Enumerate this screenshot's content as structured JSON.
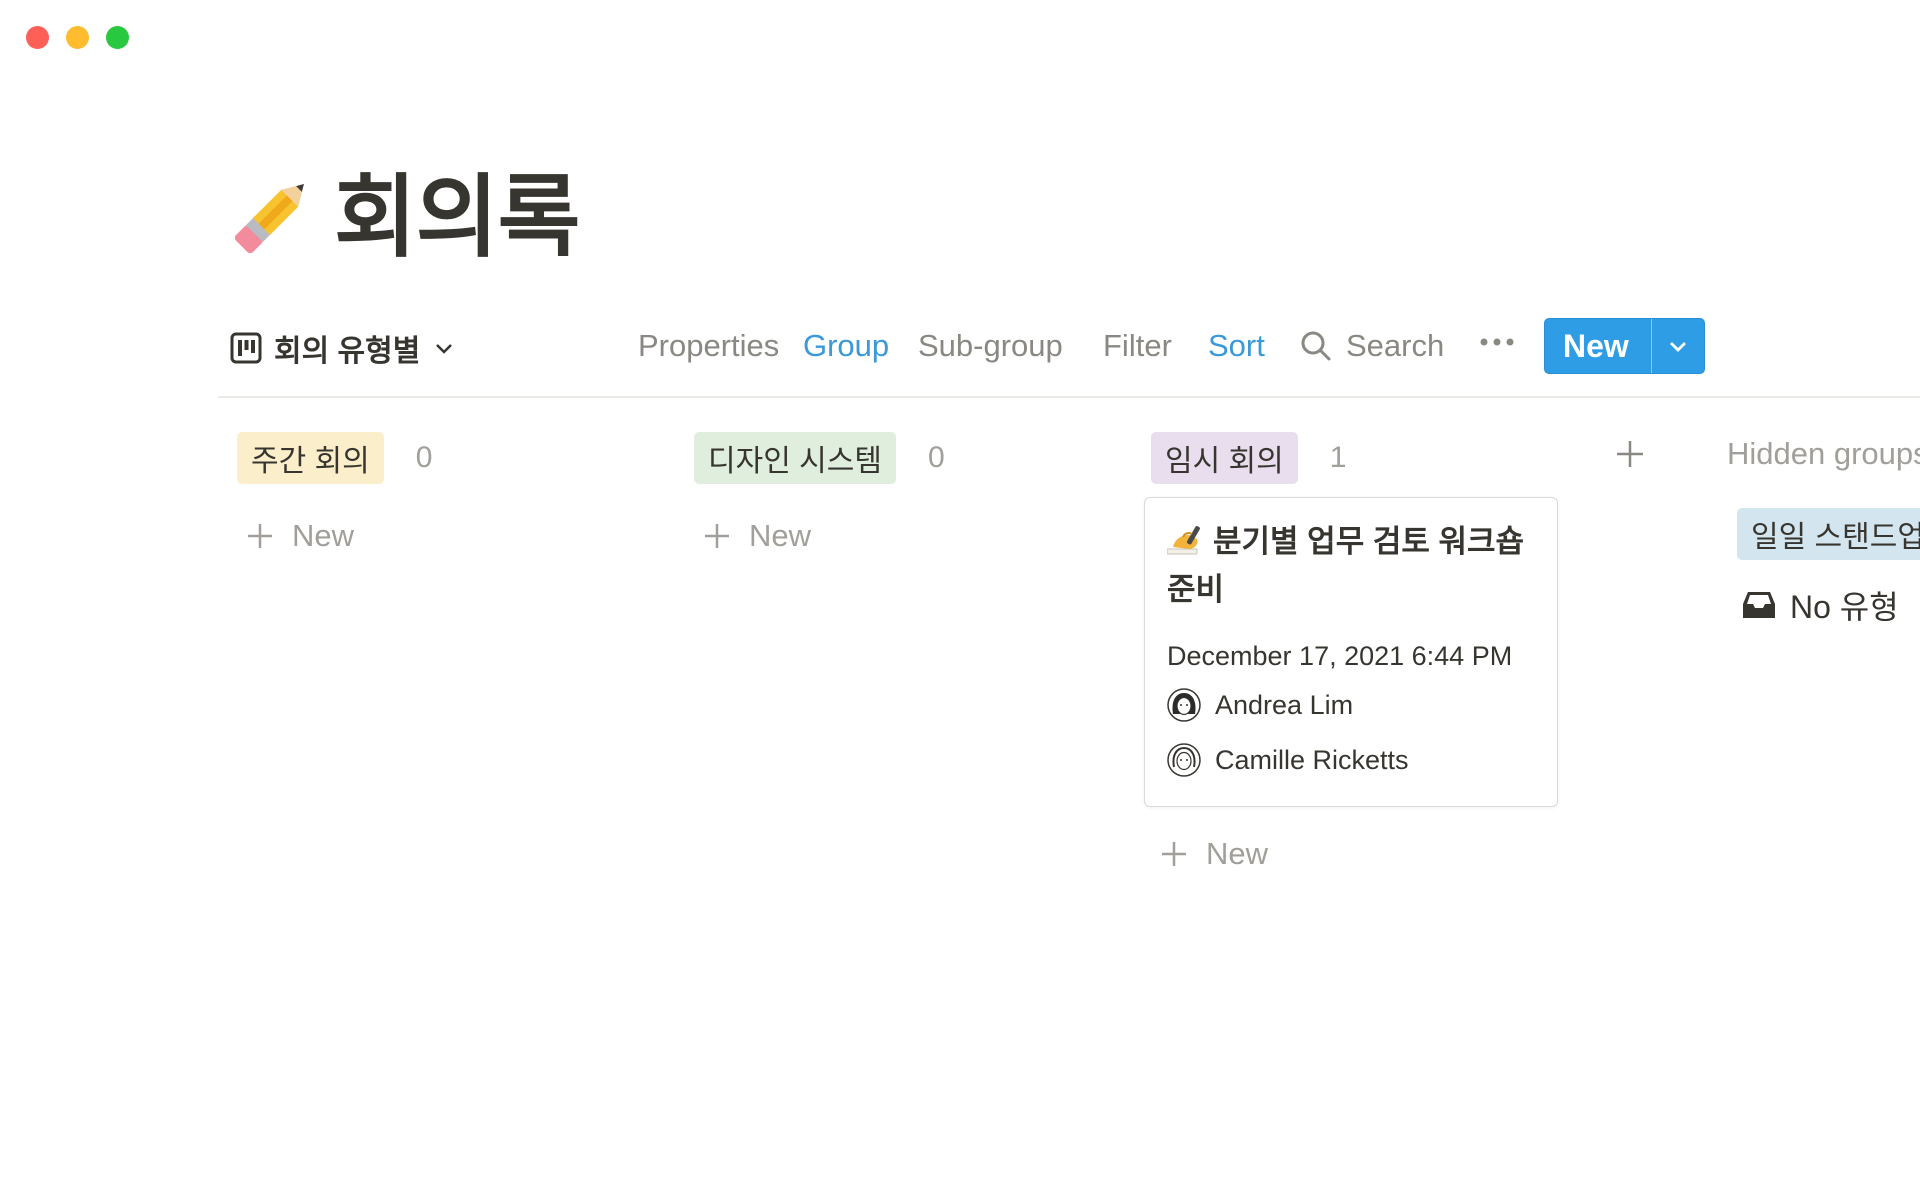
{
  "window": {
    "controls": [
      "close",
      "minimize",
      "zoom"
    ]
  },
  "page": {
    "icon": "pencil-icon",
    "title": "회의록"
  },
  "toolbar": {
    "view_name": "회의 유형별",
    "view_icon": "board-view-icon",
    "properties": "Properties",
    "group": "Group",
    "subgroup": "Sub-group",
    "filter": "Filter",
    "sort": "Sort",
    "search": "Search",
    "new_label": "New",
    "accent": "#2e9de6",
    "active_color": "#3a99d8"
  },
  "board": {
    "columns": [
      {
        "tag": "주간 회의",
        "tag_color": "#fbeecb",
        "count": "0",
        "new_label": "New"
      },
      {
        "tag": "디자인 시스템",
        "tag_color": "#dfeedd",
        "count": "0",
        "new_label": "New"
      },
      {
        "tag": "임시 회의",
        "tag_color": "#e8deee",
        "count": "1",
        "new_label": "New"
      }
    ],
    "card": {
      "emoji": "writing-hand-icon",
      "title": "분기별 업무 검토 워크숍 준비",
      "date": "December 17, 2021 6:44 PM",
      "people": [
        {
          "name": "Andrea Lim",
          "avatar": "avatar-icon"
        },
        {
          "name": "Camille Ricketts",
          "avatar": "avatar-icon"
        }
      ]
    },
    "hidden": {
      "label": "Hidden groups",
      "tag": "일일 스탠드업",
      "tag_color": "#d3e5ef",
      "no_type": "No 유형"
    }
  }
}
